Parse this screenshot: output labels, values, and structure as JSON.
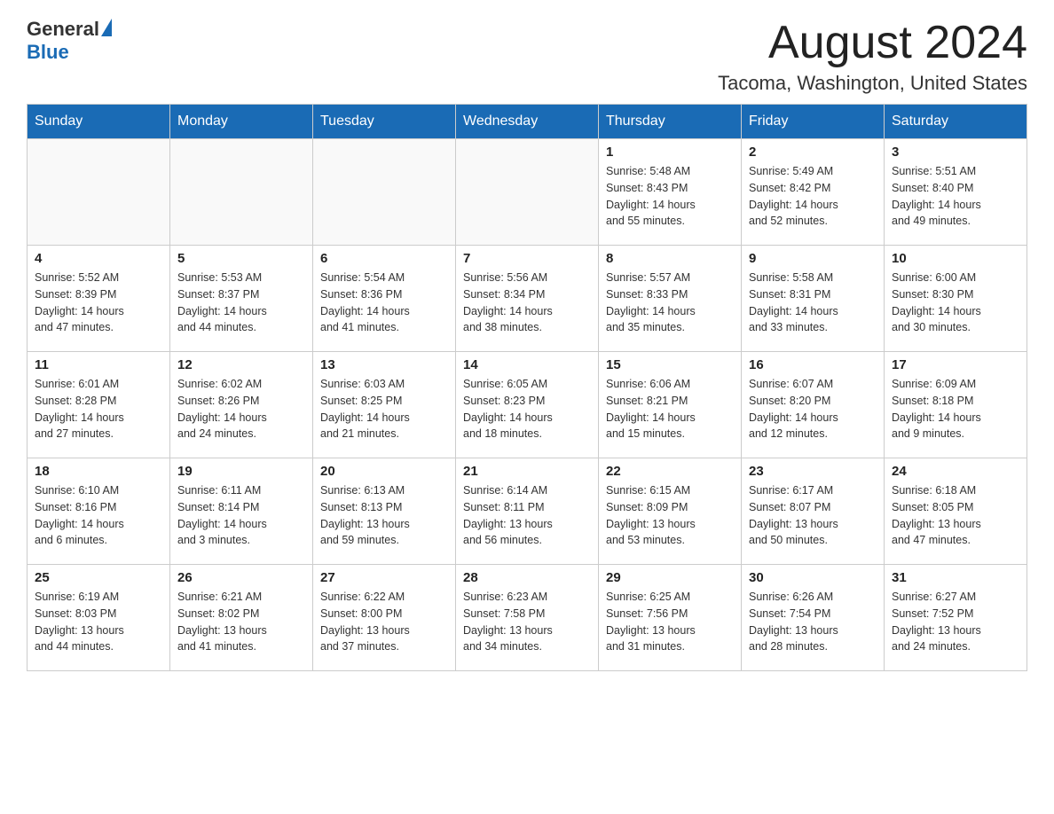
{
  "header": {
    "logo": {
      "general": "General",
      "blue": "Blue"
    },
    "month_title": "August 2024",
    "location": "Tacoma, Washington, United States"
  },
  "days_of_week": [
    "Sunday",
    "Monday",
    "Tuesday",
    "Wednesday",
    "Thursday",
    "Friday",
    "Saturday"
  ],
  "weeks": [
    {
      "days": [
        {
          "number": "",
          "info": ""
        },
        {
          "number": "",
          "info": ""
        },
        {
          "number": "",
          "info": ""
        },
        {
          "number": "",
          "info": ""
        },
        {
          "number": "1",
          "info": "Sunrise: 5:48 AM\nSunset: 8:43 PM\nDaylight: 14 hours\nand 55 minutes."
        },
        {
          "number": "2",
          "info": "Sunrise: 5:49 AM\nSunset: 8:42 PM\nDaylight: 14 hours\nand 52 minutes."
        },
        {
          "number": "3",
          "info": "Sunrise: 5:51 AM\nSunset: 8:40 PM\nDaylight: 14 hours\nand 49 minutes."
        }
      ]
    },
    {
      "days": [
        {
          "number": "4",
          "info": "Sunrise: 5:52 AM\nSunset: 8:39 PM\nDaylight: 14 hours\nand 47 minutes."
        },
        {
          "number": "5",
          "info": "Sunrise: 5:53 AM\nSunset: 8:37 PM\nDaylight: 14 hours\nand 44 minutes."
        },
        {
          "number": "6",
          "info": "Sunrise: 5:54 AM\nSunset: 8:36 PM\nDaylight: 14 hours\nand 41 minutes."
        },
        {
          "number": "7",
          "info": "Sunrise: 5:56 AM\nSunset: 8:34 PM\nDaylight: 14 hours\nand 38 minutes."
        },
        {
          "number": "8",
          "info": "Sunrise: 5:57 AM\nSunset: 8:33 PM\nDaylight: 14 hours\nand 35 minutes."
        },
        {
          "number": "9",
          "info": "Sunrise: 5:58 AM\nSunset: 8:31 PM\nDaylight: 14 hours\nand 33 minutes."
        },
        {
          "number": "10",
          "info": "Sunrise: 6:00 AM\nSunset: 8:30 PM\nDaylight: 14 hours\nand 30 minutes."
        }
      ]
    },
    {
      "days": [
        {
          "number": "11",
          "info": "Sunrise: 6:01 AM\nSunset: 8:28 PM\nDaylight: 14 hours\nand 27 minutes."
        },
        {
          "number": "12",
          "info": "Sunrise: 6:02 AM\nSunset: 8:26 PM\nDaylight: 14 hours\nand 24 minutes."
        },
        {
          "number": "13",
          "info": "Sunrise: 6:03 AM\nSunset: 8:25 PM\nDaylight: 14 hours\nand 21 minutes."
        },
        {
          "number": "14",
          "info": "Sunrise: 6:05 AM\nSunset: 8:23 PM\nDaylight: 14 hours\nand 18 minutes."
        },
        {
          "number": "15",
          "info": "Sunrise: 6:06 AM\nSunset: 8:21 PM\nDaylight: 14 hours\nand 15 minutes."
        },
        {
          "number": "16",
          "info": "Sunrise: 6:07 AM\nSunset: 8:20 PM\nDaylight: 14 hours\nand 12 minutes."
        },
        {
          "number": "17",
          "info": "Sunrise: 6:09 AM\nSunset: 8:18 PM\nDaylight: 14 hours\nand 9 minutes."
        }
      ]
    },
    {
      "days": [
        {
          "number": "18",
          "info": "Sunrise: 6:10 AM\nSunset: 8:16 PM\nDaylight: 14 hours\nand 6 minutes."
        },
        {
          "number": "19",
          "info": "Sunrise: 6:11 AM\nSunset: 8:14 PM\nDaylight: 14 hours\nand 3 minutes."
        },
        {
          "number": "20",
          "info": "Sunrise: 6:13 AM\nSunset: 8:13 PM\nDaylight: 13 hours\nand 59 minutes."
        },
        {
          "number": "21",
          "info": "Sunrise: 6:14 AM\nSunset: 8:11 PM\nDaylight: 13 hours\nand 56 minutes."
        },
        {
          "number": "22",
          "info": "Sunrise: 6:15 AM\nSunset: 8:09 PM\nDaylight: 13 hours\nand 53 minutes."
        },
        {
          "number": "23",
          "info": "Sunrise: 6:17 AM\nSunset: 8:07 PM\nDaylight: 13 hours\nand 50 minutes."
        },
        {
          "number": "24",
          "info": "Sunrise: 6:18 AM\nSunset: 8:05 PM\nDaylight: 13 hours\nand 47 minutes."
        }
      ]
    },
    {
      "days": [
        {
          "number": "25",
          "info": "Sunrise: 6:19 AM\nSunset: 8:03 PM\nDaylight: 13 hours\nand 44 minutes."
        },
        {
          "number": "26",
          "info": "Sunrise: 6:21 AM\nSunset: 8:02 PM\nDaylight: 13 hours\nand 41 minutes."
        },
        {
          "number": "27",
          "info": "Sunrise: 6:22 AM\nSunset: 8:00 PM\nDaylight: 13 hours\nand 37 minutes."
        },
        {
          "number": "28",
          "info": "Sunrise: 6:23 AM\nSunset: 7:58 PM\nDaylight: 13 hours\nand 34 minutes."
        },
        {
          "number": "29",
          "info": "Sunrise: 6:25 AM\nSunset: 7:56 PM\nDaylight: 13 hours\nand 31 minutes."
        },
        {
          "number": "30",
          "info": "Sunrise: 6:26 AM\nSunset: 7:54 PM\nDaylight: 13 hours\nand 28 minutes."
        },
        {
          "number": "31",
          "info": "Sunrise: 6:27 AM\nSunset: 7:52 PM\nDaylight: 13 hours\nand 24 minutes."
        }
      ]
    }
  ]
}
